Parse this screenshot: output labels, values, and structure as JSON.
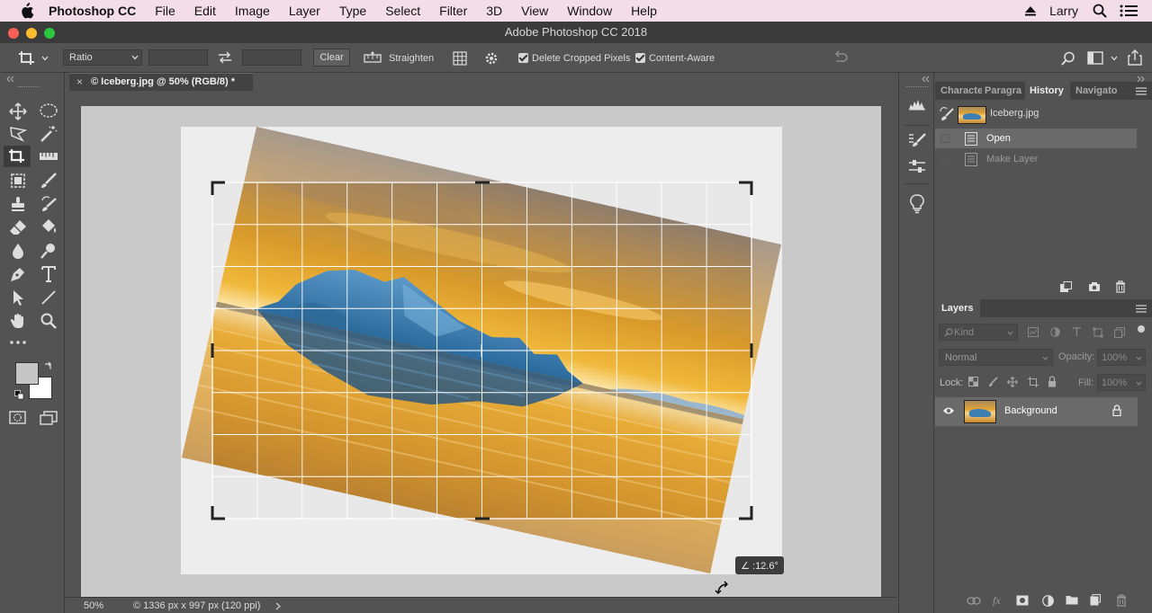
{
  "menubar": {
    "app_name": "Photoshop CC",
    "items": [
      "File",
      "Edit",
      "Image",
      "Layer",
      "Type",
      "Select",
      "Filter",
      "3D",
      "View",
      "Window",
      "Help"
    ],
    "user": "Larry"
  },
  "window": {
    "title": "Adobe Photoshop CC 2018"
  },
  "options": {
    "ratio_label": "Ratio",
    "width_value": "",
    "height_value": "",
    "clear_label": "Clear",
    "straighten_label": "Straighten",
    "delete_cropped_label": "Delete Cropped Pixels",
    "delete_cropped_checked": true,
    "content_aware_label": "Content-Aware",
    "content_aware_checked": true
  },
  "document": {
    "tab_title": "© Iceberg.jpg @ 50% (RGB/8) *",
    "rotation_readout": "∠ :12.6°"
  },
  "status": {
    "zoom": "50%",
    "info": "© 1336 px x 997 px (120 ppi)"
  },
  "history_panel": {
    "tabs": [
      "Characte",
      "Paragra",
      "History",
      "Navigato"
    ],
    "active_tab": "History",
    "snapshot_name": "Iceberg.jpg",
    "states": [
      {
        "label": "Open",
        "active": true
      },
      {
        "label": "Make Layer",
        "active": false
      }
    ]
  },
  "layers_panel": {
    "title": "Layers",
    "filter_placeholder": "Kind",
    "blend_mode": "Normal",
    "opacity_label": "Opacity:",
    "opacity_value": "100%",
    "lock_label": "Lock:",
    "fill_label": "Fill:",
    "fill_value": "100%",
    "layers": [
      {
        "name": "Background",
        "visible": true,
        "locked": true
      }
    ]
  },
  "colors": {
    "accent_sky": "#e8a326",
    "iceberg_blue": "#3d7fb2",
    "panel_bg": "#535353",
    "menubar_bg": "#f3dde6"
  }
}
